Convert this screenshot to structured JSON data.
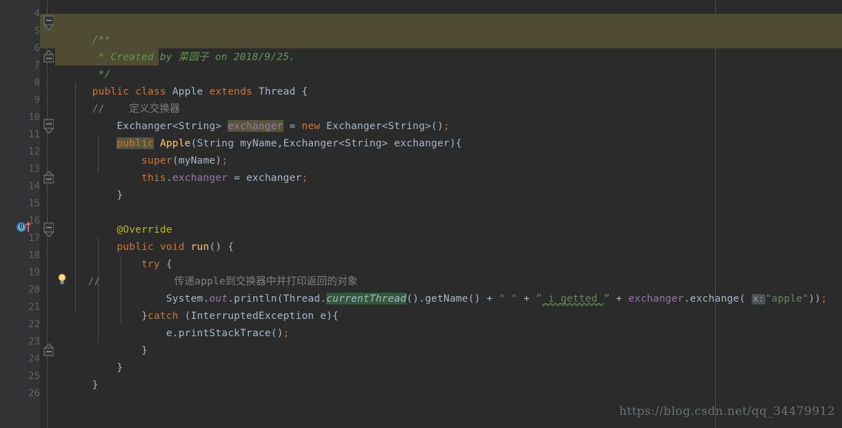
{
  "editor": {
    "theme_bg": "#2b2b2b",
    "gutter_bg": "#313335",
    "highlight_band_color": "#4f4c33",
    "usage_highlight_color": "#57553a",
    "first_line": 4,
    "last_line": 26
  },
  "line_numbers": [
    "4",
    "5",
    "6",
    "7",
    "8",
    "9",
    "10",
    "11",
    "12",
    "13",
    "14",
    "15",
    "16",
    "17",
    "18",
    "19",
    "20",
    "21",
    "22",
    "23",
    "24",
    "25",
    "26"
  ],
  "gutter_icons": {
    "override_marker": {
      "line": 17,
      "glyph": "O",
      "name": "override-method-marker",
      "color": "#6ab0de"
    },
    "implements_arrow": {
      "line": 17,
      "name": "implementing-method-arrow",
      "color": "#e06c5c"
    },
    "intention_bulb": {
      "line": 20,
      "name": "intention-bulb",
      "color": "#f0c674"
    }
  },
  "code_lines": [
    {
      "n": "4",
      "text": ""
    },
    {
      "n": "5",
      "text": "/**"
    },
    {
      "n": "6",
      "text": " * Created by 菜园子 on 2018/9/25."
    },
    {
      "n": "7",
      "text": " */"
    },
    {
      "n": "8",
      "text": "public class Apple extends Thread {"
    },
    {
      "n": "9",
      "text": "//    定义交换器"
    },
    {
      "n": "10",
      "text": "    Exchanger<String> exchanger = new Exchanger<String>();"
    },
    {
      "n": "11",
      "text": "    public Apple(String myName,Exchanger<String> exchanger){"
    },
    {
      "n": "12",
      "text": "        super(myName);"
    },
    {
      "n": "13",
      "text": "        this.exchanger = exchanger;"
    },
    {
      "n": "14",
      "text": "    }"
    },
    {
      "n": "15",
      "text": ""
    },
    {
      "n": "16",
      "text": "    @Override"
    },
    {
      "n": "17",
      "text": "    public void run() {"
    },
    {
      "n": "18",
      "text": "        try {"
    },
    {
      "n": "19",
      "text": "//            传递apple到交换器中并打印返回的对象"
    },
    {
      "n": "20",
      "text": "            System.out.println(Thread.currentThread().getName() + \" \" + \" i getted \" + exchanger.exchange( x: \"apple\"));"
    },
    {
      "n": "21",
      "text": "        }catch (InterruptedException e){"
    },
    {
      "n": "22",
      "text": "            e.printStackTrace();"
    },
    {
      "n": "23",
      "text": "        }"
    },
    {
      "n": "24",
      "text": "    }"
    },
    {
      "n": "25",
      "text": "}"
    },
    {
      "n": "26",
      "text": ""
    }
  ],
  "tokens": {
    "javadoc_open": "/**",
    "javadoc_body": " * Created by 菜园子 on 2018/9/25.",
    "javadoc_close": " */",
    "kw_public": "public",
    "kw_class": "class",
    "type_Apple": "Apple",
    "kw_extends": "extends",
    "type_Thread": "Thread",
    "brace_open": "{",
    "brace_close": "}",
    "comment_define_exchanger": "//    定义交换器",
    "type_ExchangerString": "Exchanger<String>",
    "field_exchanger": "exchanger",
    "op_assign": "=",
    "kw_new": "new",
    "ctor_ExchangerString": "Exchanger<String>()",
    "semi": ";",
    "ctor_name": "Apple",
    "param_String": "String",
    "param_myName": "myName",
    "param_ExchangerString": "Exchanger<String>",
    "param_exchanger": "exchanger",
    "kw_super": "super",
    "kw_this": "this",
    "annotation_override": "@Override",
    "kw_void": "void",
    "method_run": "run",
    "kw_try": "try",
    "comment_pass_apple": "//            传递apple到交换器中并打印返回的对象",
    "cls_System": "System",
    "field_out": "out",
    "method_println": "println",
    "cls_Thread": "Thread",
    "method_currentThread": "currentThread",
    "method_getName": "getName",
    "str_space": "\" \"",
    "str_i_getted": "\" i getted \"",
    "typo_word": "getted",
    "method_exchange": "exchange",
    "param_hint_x": "x:",
    "str_apple": "\"apple\"",
    "kw_catch": "catch",
    "type_InterruptedException": "InterruptedException",
    "var_e": "e",
    "method_printStackTrace": "printStackTrace"
  },
  "watermark": {
    "text": "https://blog.csdn.net/qq_34479912"
  }
}
